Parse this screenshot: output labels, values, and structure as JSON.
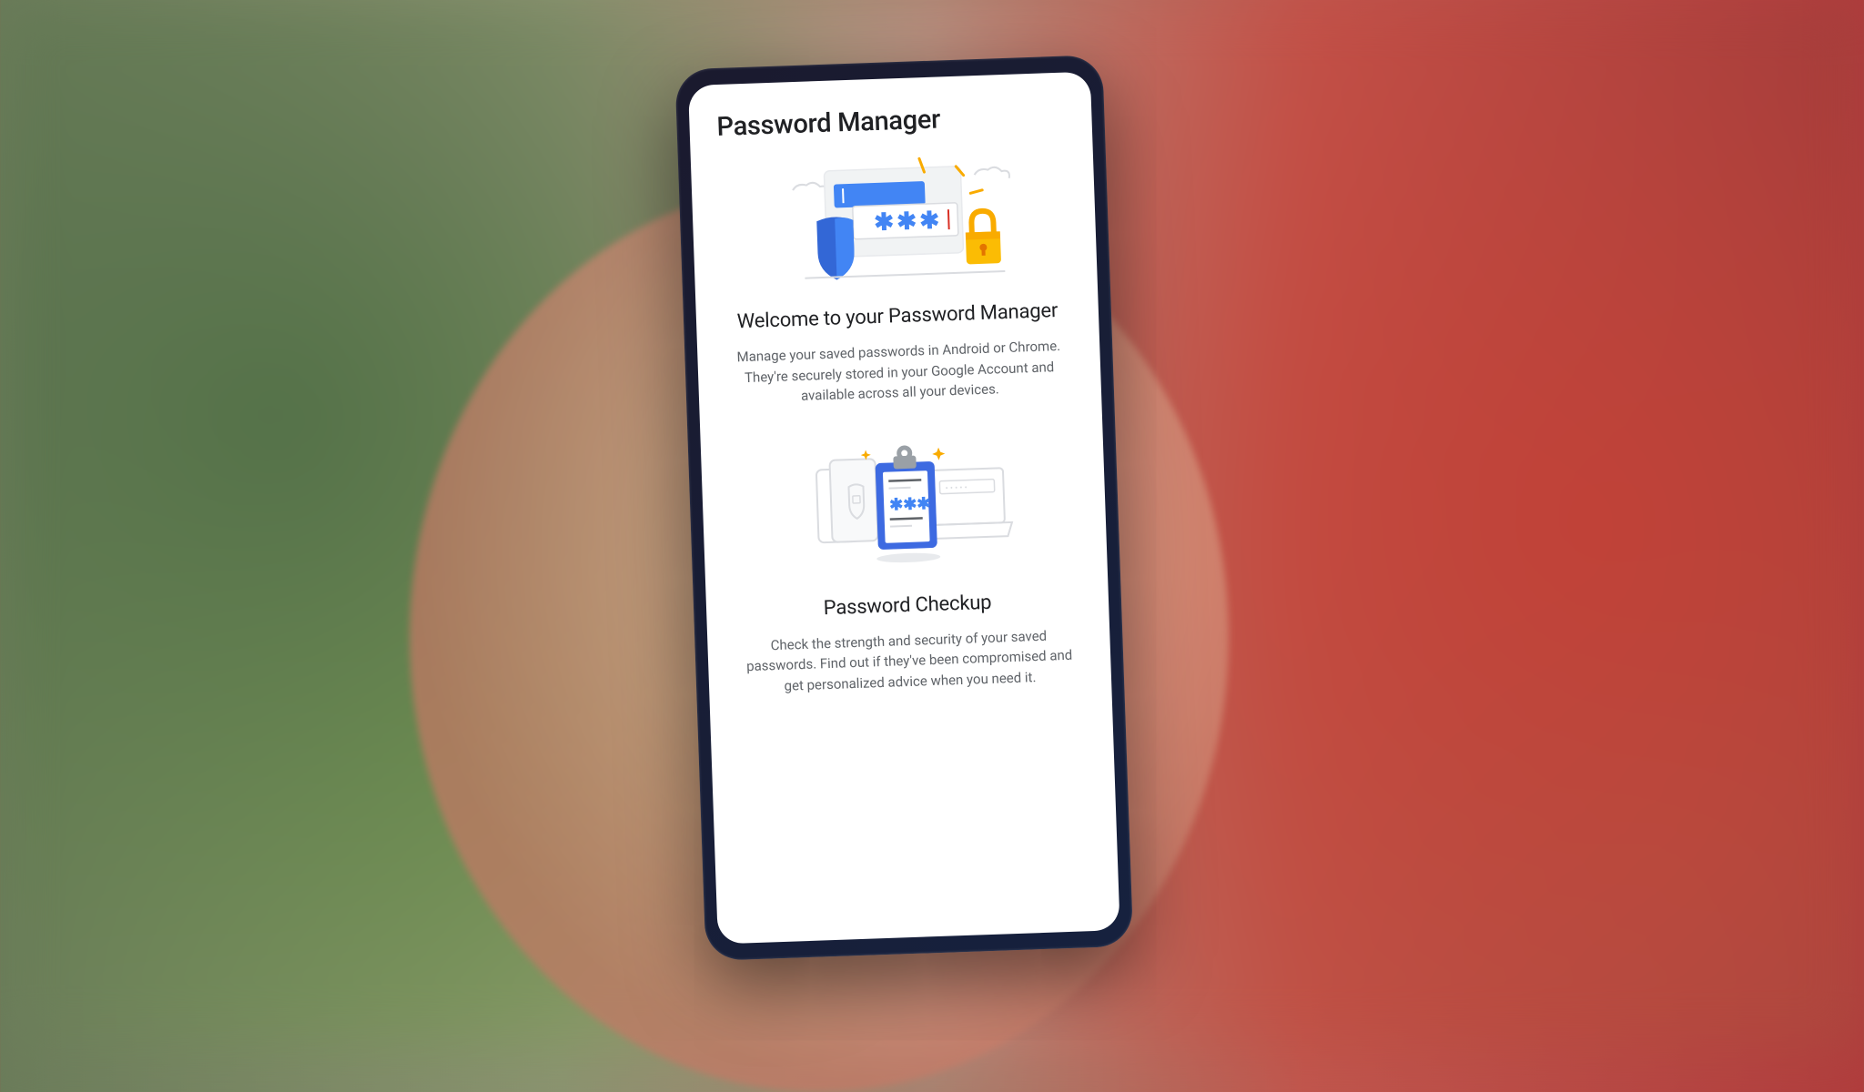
{
  "header": {
    "title": "Password Manager"
  },
  "sections": {
    "welcome": {
      "heading": "Welcome to your Password Manager",
      "body": "Manage your saved passwords in Android or Chrome. They're securely stored in your Google Account and available across all your devices."
    },
    "checkup": {
      "heading": "Password Checkup",
      "body": "Check the strength and security of your saved passwords. Find out if they've been compromised and get personalized advice when you need it."
    }
  },
  "colors": {
    "primary_blue": "#4285f4",
    "dark_blue": "#1a73e8",
    "shield_blue": "#3367d6",
    "lock_orange": "#f9ab00",
    "lock_body": "#fbbc04",
    "accent_yellow": "#f9ab00",
    "text_primary": "#202124",
    "text_secondary": "#5f6368",
    "light_gray": "#dadce0"
  }
}
